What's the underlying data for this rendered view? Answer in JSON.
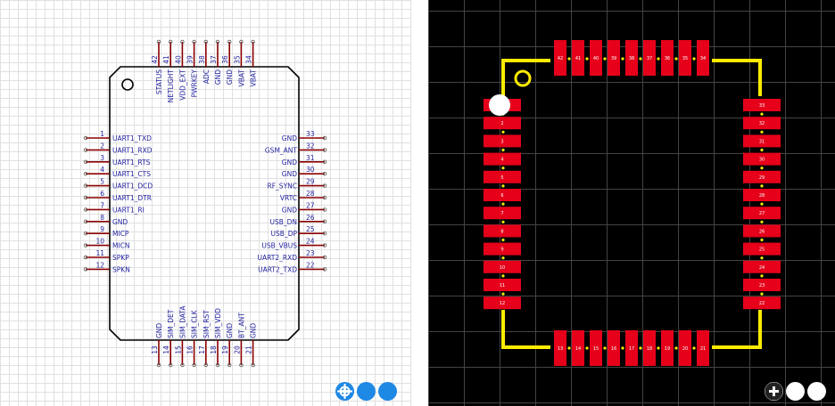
{
  "colors": {
    "schematic_body": "#000000",
    "schematic_pin_line": "#8b0000",
    "schematic_text": "#1f1f9f",
    "pcb_background": "#000000",
    "pcb_grid": "#444444",
    "pcb_pad": "#e6001a",
    "pcb_outline": "#ffeb00",
    "pcb_pad_text": "#ffffff",
    "zoom_schematic": "#1e88e5",
    "zoom_pcb": "#ffffff"
  },
  "icons": {
    "locate": "target-icon",
    "zoom_out": "minus-icon",
    "zoom_in": "plus-icon"
  },
  "schematic": {
    "left_pins": [
      {
        "num": "1",
        "name": "UART1_TXD"
      },
      {
        "num": "2",
        "name": "UART1_RXD"
      },
      {
        "num": "3",
        "name": "UART1_RTS"
      },
      {
        "num": "4",
        "name": "UART1_CTS"
      },
      {
        "num": "5",
        "name": "UART1_DCD"
      },
      {
        "num": "6",
        "name": "UART1_DTR"
      },
      {
        "num": "7",
        "name": "UART1_RI"
      },
      {
        "num": "8",
        "name": "GND"
      },
      {
        "num": "9",
        "name": "MICP"
      },
      {
        "num": "10",
        "name": "MICN"
      },
      {
        "num": "11",
        "name": "SPKP"
      },
      {
        "num": "12",
        "name": "SPKN"
      }
    ],
    "right_pins": [
      {
        "num": "33",
        "name": "GND"
      },
      {
        "num": "32",
        "name": "GSM_ANT"
      },
      {
        "num": "31",
        "name": "GND"
      },
      {
        "num": "30",
        "name": "GND"
      },
      {
        "num": "29",
        "name": "RF_SYNC"
      },
      {
        "num": "28",
        "name": "VRTC"
      },
      {
        "num": "27",
        "name": "GND"
      },
      {
        "num": "26",
        "name": "USB_DN"
      },
      {
        "num": "25",
        "name": "USB_DP"
      },
      {
        "num": "24",
        "name": "USB_VBUS"
      },
      {
        "num": "23",
        "name": "UART2_RXD"
      },
      {
        "num": "22",
        "name": "UART2_TXD"
      }
    ],
    "top_pins": [
      {
        "num": "42",
        "name": "STATUS"
      },
      {
        "num": "41",
        "name": "NETLIGHT"
      },
      {
        "num": "40",
        "name": "VDD_EXT"
      },
      {
        "num": "39",
        "name": "PWRKEY"
      },
      {
        "num": "38",
        "name": "ADC"
      },
      {
        "num": "37",
        "name": "GND"
      },
      {
        "num": "36",
        "name": "GND"
      },
      {
        "num": "35",
        "name": "VBAT"
      },
      {
        "num": "34",
        "name": "VBAT"
      }
    ],
    "bottom_pins": [
      {
        "num": "13",
        "name": "GND"
      },
      {
        "num": "14",
        "name": "SIM_DET"
      },
      {
        "num": "15",
        "name": "SIM_DATA"
      },
      {
        "num": "16",
        "name": "SIM_CLK"
      },
      {
        "num": "17",
        "name": "SIM_RST"
      },
      {
        "num": "18",
        "name": "SIM_VDD"
      },
      {
        "num": "19",
        "name": "GND"
      },
      {
        "num": "20",
        "name": "BT_ANT"
      },
      {
        "num": "21",
        "name": "GND"
      }
    ]
  },
  "pcb": {
    "left_pads": [
      "1",
      "2",
      "3",
      "4",
      "5",
      "6",
      "7",
      "8",
      "9",
      "10",
      "11",
      "12"
    ],
    "right_pads": [
      "33",
      "32",
      "31",
      "30",
      "29",
      "28",
      "27",
      "26",
      "25",
      "24",
      "23",
      "22"
    ],
    "top_pads": [
      "42",
      "41",
      "40",
      "39",
      "38",
      "37",
      "36",
      "35",
      "34"
    ],
    "bottom_pads": [
      "13",
      "14",
      "15",
      "16",
      "17",
      "18",
      "19",
      "20",
      "21"
    ]
  }
}
